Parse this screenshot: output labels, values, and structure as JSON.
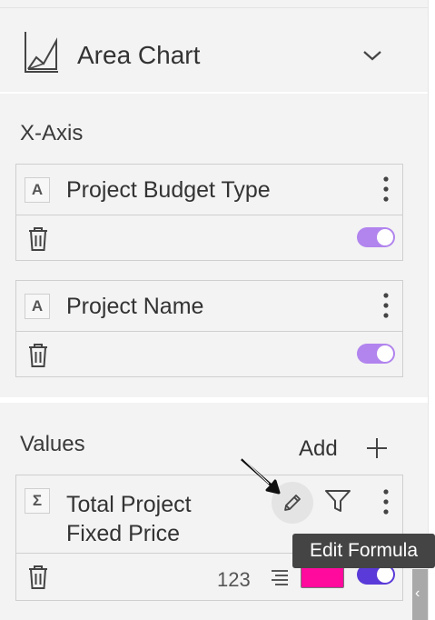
{
  "chart_type": {
    "label": "Area Chart",
    "icon": "area-chart-icon"
  },
  "x_axis": {
    "title": "X-Axis",
    "fields": [
      {
        "type_glyph": "A",
        "label": "Project Budget Type",
        "enabled": true
      },
      {
        "type_glyph": "A",
        "label": "Project Name",
        "enabled": true
      }
    ]
  },
  "values": {
    "title": "Values",
    "add_label": "Add",
    "fields": [
      {
        "type_glyph": "Σ",
        "label_line1": "Total Project",
        "label_line2": "Fixed Price",
        "number_format": "123",
        "series_color": "#ff0a9d",
        "enabled": true
      }
    ]
  },
  "tooltip": {
    "text": "Edit Formula"
  },
  "colors": {
    "toggle_on": "#b184ee",
    "toggle_active": "#5a3ad8",
    "tooltip_bg": "#444444"
  }
}
